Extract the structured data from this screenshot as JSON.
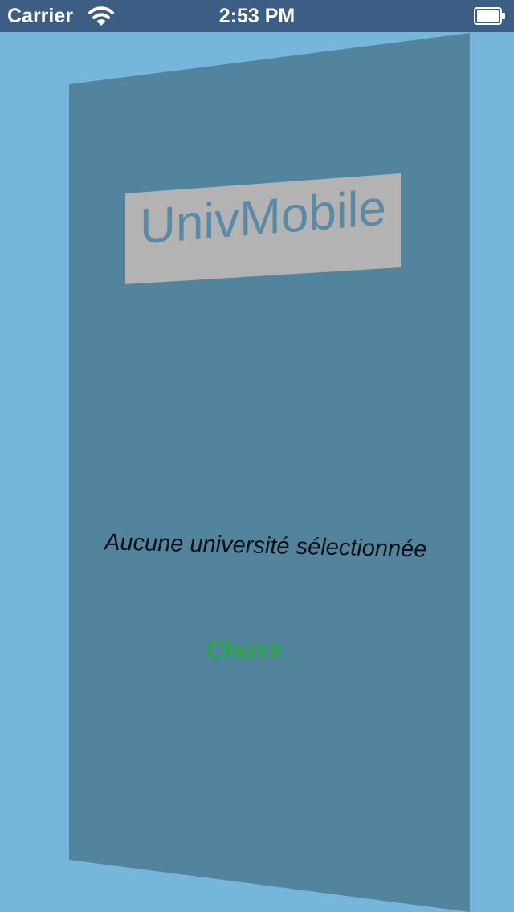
{
  "status_bar": {
    "carrier": "Carrier",
    "time": "2:53 PM",
    "icons": [
      "wifi-icon",
      "battery-icon"
    ]
  },
  "app": {
    "title": "UnivMobile",
    "status_message": "Aucune université sélectionnée",
    "choose_label": "Choisir…"
  },
  "colors": {
    "background": "#76b6da",
    "status_bar": "#3d5e84",
    "panel": "#52849d",
    "title_box": "#b3b3b3",
    "title_text": "#5a8aa6",
    "choose_link": "#1db41d"
  }
}
